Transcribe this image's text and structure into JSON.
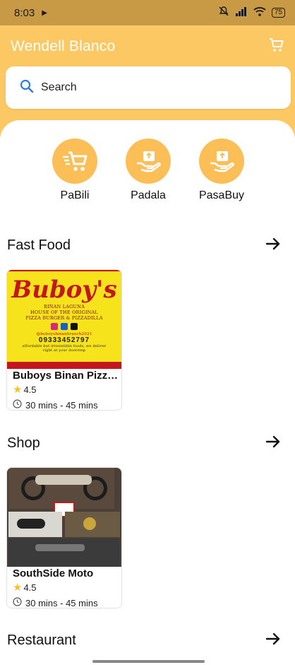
{
  "status_bar": {
    "time": "8:03",
    "battery": "75"
  },
  "app_bar": {
    "title": "Wendell Blanco"
  },
  "search": {
    "label": "Search"
  },
  "services": [
    {
      "label": "PaBili",
      "icon": "shopping-cart-icon"
    },
    {
      "label": "Padala",
      "icon": "package-hand-icon"
    },
    {
      "label": "PasaBuy",
      "icon": "package-hand-icon"
    }
  ],
  "sections": [
    {
      "title": "Fast Food",
      "stores": [
        {
          "name": "Buboys Binan Pizz…",
          "rating": "4.5",
          "eta": "30 mins - 45 mins",
          "image": {
            "logo": "Buboy's",
            "lines": [
              "BIÑAN LAGUNA",
              "HOUSE OF THE ORIGINAL",
              "PIZZA BURGER & PIZZADILLA"
            ],
            "handle": "@buboysbinanbranch2021",
            "phone": "09333452797",
            "tagline": "affordable but irresistible foods, we deliver right at your doorstep"
          }
        }
      ]
    },
    {
      "title": "Shop",
      "stores": [
        {
          "name": "SouthSide Moto",
          "rating": "4.5",
          "eta": "30 mins - 45 mins"
        }
      ]
    },
    {
      "title": "Restaurant",
      "stores": []
    }
  ],
  "colors": {
    "header": "#fcc864",
    "status_bar": "#c89a46",
    "service_circle": "#fcbf58",
    "star": "#f2c230",
    "search_icon": "#2b7bd9"
  }
}
